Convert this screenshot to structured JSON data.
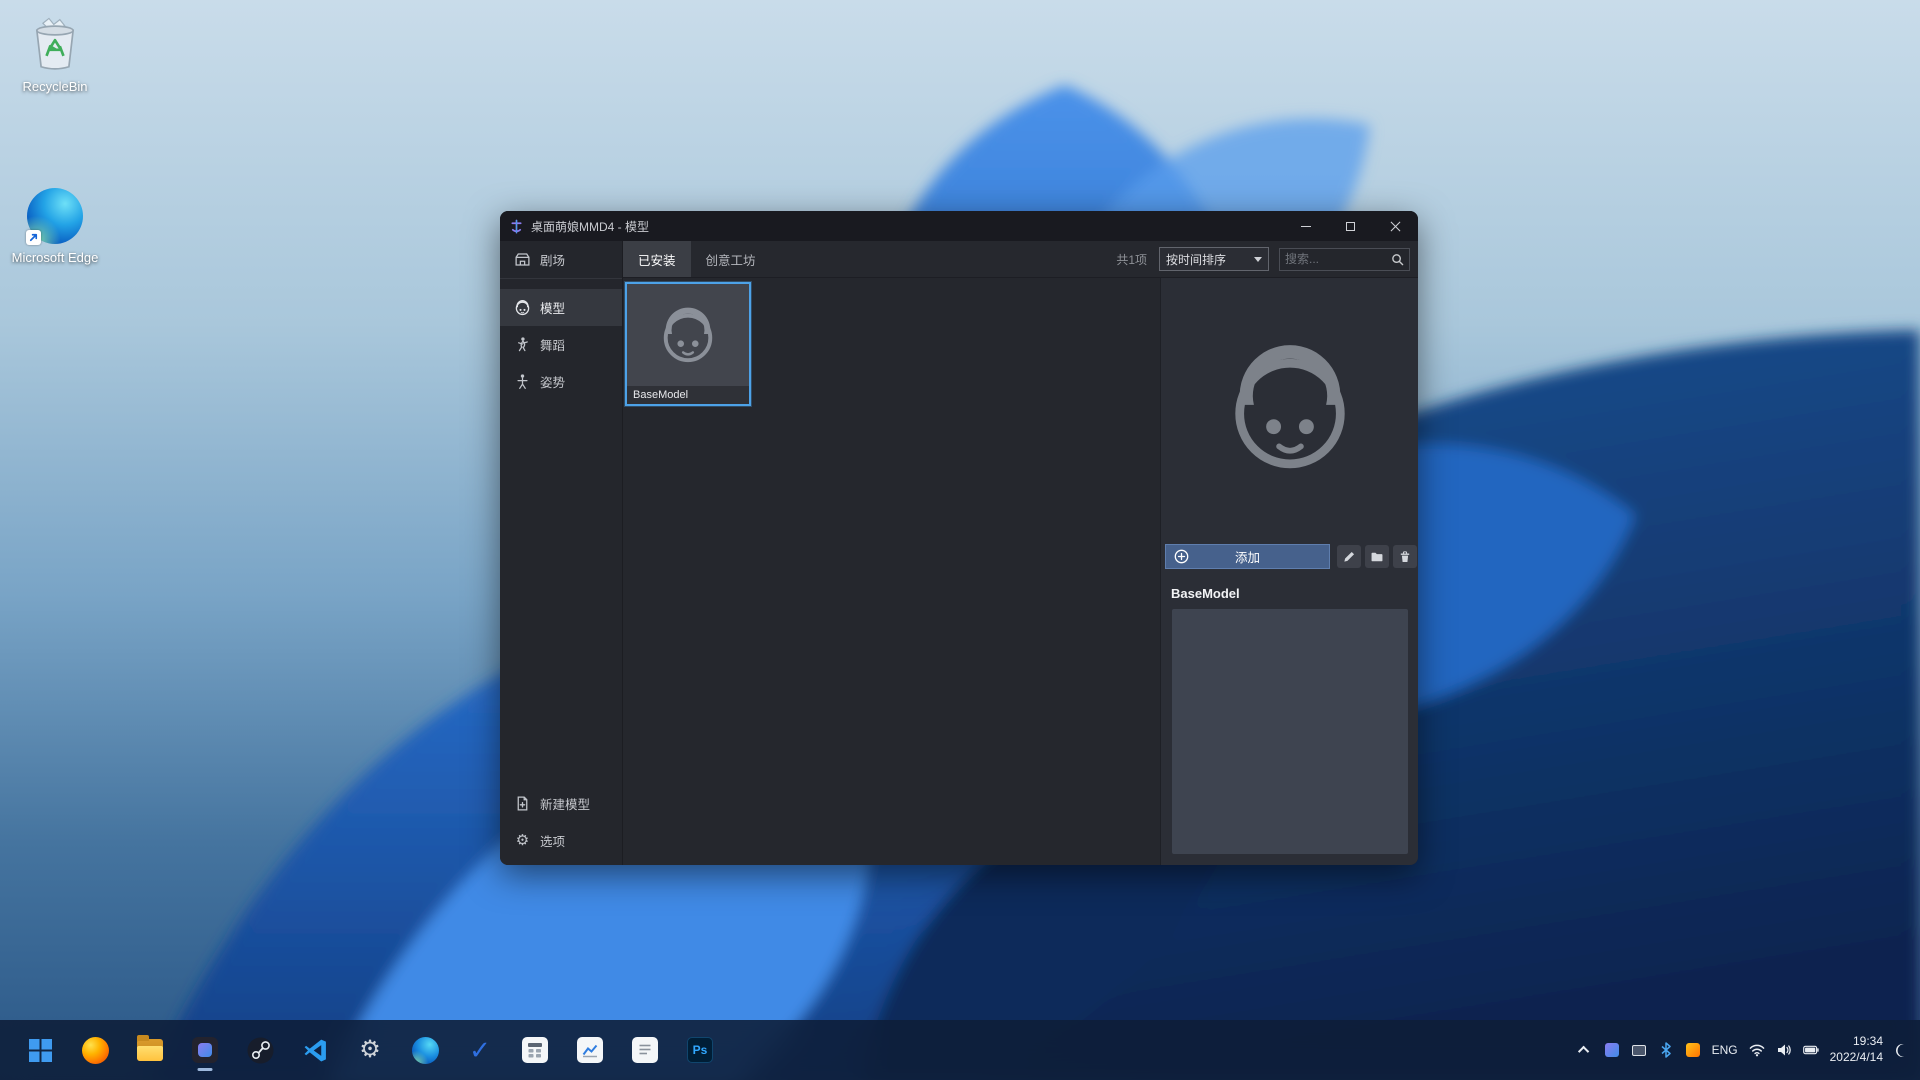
{
  "colors": {
    "selection_blue": "#4da2e8",
    "add_button_blue": "#46618c",
    "accent_taskbar": "#0e1e38"
  },
  "desktop": {
    "icons": [
      {
        "name": "recycle-bin",
        "label": "RecycleBin"
      },
      {
        "name": "microsoft-edge",
        "label": "Microsoft Edge"
      }
    ]
  },
  "window": {
    "title": "桌面萌娘MMD4 - 模型",
    "sidebar": {
      "theater_label": "剧场",
      "items": [
        {
          "label": "模型",
          "selected": true
        },
        {
          "label": "舞蹈",
          "selected": false
        },
        {
          "label": "姿势",
          "selected": false
        }
      ],
      "new_model_label": "新建模型",
      "options_label": "选项"
    },
    "toolbar": {
      "tabs": [
        {
          "label": "已安装",
          "selected": true
        },
        {
          "label": "创意工坊",
          "selected": false
        }
      ],
      "count_label": "共1项",
      "sort_label": "按时间排序",
      "search_placeholder": "搜索..."
    },
    "grid": {
      "items": [
        {
          "name": "BaseModel",
          "selected": true
        }
      ]
    },
    "detail": {
      "add_label": "添加",
      "model_name": "BaseModel",
      "description": ""
    }
  },
  "taskbar": {
    "icon_names": [
      "start",
      "firefox",
      "file-explorer",
      "desktop-mmd",
      "steam",
      "vscode",
      "settings",
      "edge",
      "microsoft-todo",
      "calculator",
      "task-manager",
      "notepad",
      "photoshop"
    ],
    "photoshop_label": "Ps",
    "tray": {
      "language": "ENG",
      "time": "19:34",
      "date": "2022/4/14"
    }
  }
}
